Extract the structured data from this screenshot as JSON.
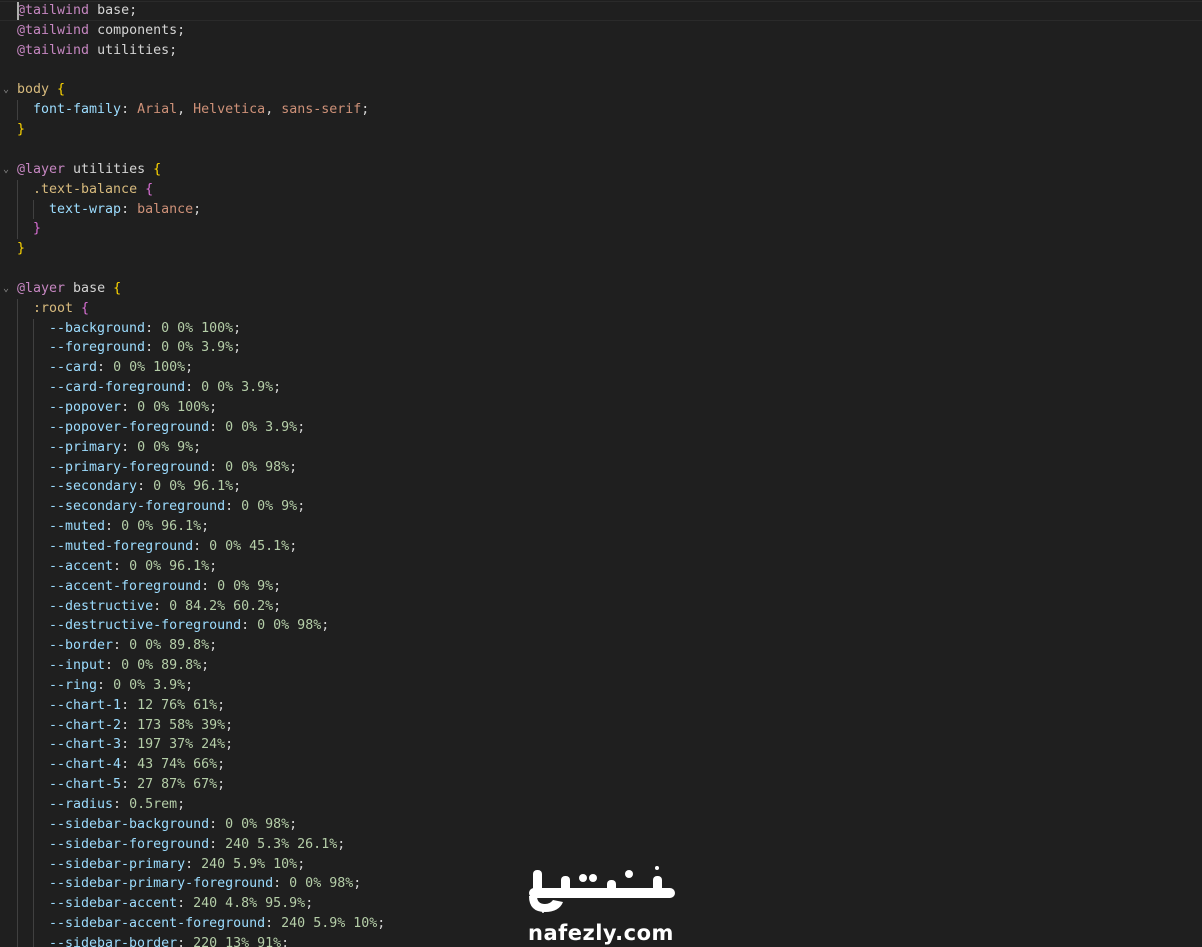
{
  "code": {
    "lines": [
      {
        "tokens": [
          {
            "t": "@tailwind",
            "c": "at"
          },
          {
            "t": " base",
            "c": "plain"
          },
          {
            "t": ";",
            "c": "punct"
          }
        ]
      },
      {
        "tokens": [
          {
            "t": "@tailwind",
            "c": "at"
          },
          {
            "t": " components",
            "c": "plain"
          },
          {
            "t": ";",
            "c": "punct"
          }
        ]
      },
      {
        "tokens": [
          {
            "t": "@tailwind",
            "c": "at"
          },
          {
            "t": " utilities",
            "c": "plain"
          },
          {
            "t": ";",
            "c": "punct"
          }
        ]
      },
      {
        "tokens": []
      },
      {
        "fold": true,
        "tokens": [
          {
            "t": "body",
            "c": "sel"
          },
          {
            "t": " ",
            "c": "plain"
          },
          {
            "t": "{",
            "c": "brace1"
          }
        ]
      },
      {
        "indent": 1,
        "tokens": [
          {
            "t": "font-family",
            "c": "prop"
          },
          {
            "t": ": ",
            "c": "punct"
          },
          {
            "t": "Arial",
            "c": "val"
          },
          {
            "t": ", ",
            "c": "punct"
          },
          {
            "t": "Helvetica",
            "c": "val"
          },
          {
            "t": ", ",
            "c": "punct"
          },
          {
            "t": "sans-serif",
            "c": "val"
          },
          {
            "t": ";",
            "c": "punct"
          }
        ]
      },
      {
        "tokens": [
          {
            "t": "}",
            "c": "brace1"
          }
        ]
      },
      {
        "tokens": []
      },
      {
        "fold": true,
        "tokens": [
          {
            "t": "@layer",
            "c": "at"
          },
          {
            "t": " utilities ",
            "c": "plain"
          },
          {
            "t": "{",
            "c": "brace1"
          }
        ]
      },
      {
        "indent": 1,
        "fold": true,
        "tokens": [
          {
            "t": ".text-balance",
            "c": "sel"
          },
          {
            "t": " ",
            "c": "plain"
          },
          {
            "t": "{",
            "c": "brace2"
          }
        ]
      },
      {
        "indent": 2,
        "tokens": [
          {
            "t": "text-wrap",
            "c": "prop"
          },
          {
            "t": ": ",
            "c": "punct"
          },
          {
            "t": "balance",
            "c": "val"
          },
          {
            "t": ";",
            "c": "punct"
          }
        ]
      },
      {
        "indent": 1,
        "tokens": [
          {
            "t": "}",
            "c": "brace2"
          }
        ]
      },
      {
        "tokens": [
          {
            "t": "}",
            "c": "brace1"
          }
        ]
      },
      {
        "tokens": []
      },
      {
        "fold": true,
        "tokens": [
          {
            "t": "@layer",
            "c": "at"
          },
          {
            "t": " base ",
            "c": "plain"
          },
          {
            "t": "{",
            "c": "brace1"
          }
        ]
      },
      {
        "indent": 1,
        "fold": true,
        "tokens": [
          {
            "t": ":root",
            "c": "sel"
          },
          {
            "t": " ",
            "c": "plain"
          },
          {
            "t": "{",
            "c": "brace2"
          }
        ]
      },
      {
        "indent": 2,
        "tokens": [
          {
            "t": "--background",
            "c": "prop"
          },
          {
            "t": ": ",
            "c": "punct"
          },
          {
            "t": "0 0% 100%",
            "c": "num"
          },
          {
            "t": ";",
            "c": "punct"
          }
        ]
      },
      {
        "indent": 2,
        "tokens": [
          {
            "t": "--foreground",
            "c": "prop"
          },
          {
            "t": ": ",
            "c": "punct"
          },
          {
            "t": "0 0% 3.9%",
            "c": "num"
          },
          {
            "t": ";",
            "c": "punct"
          }
        ]
      },
      {
        "indent": 2,
        "tokens": [
          {
            "t": "--card",
            "c": "prop"
          },
          {
            "t": ": ",
            "c": "punct"
          },
          {
            "t": "0 0% 100%",
            "c": "num"
          },
          {
            "t": ";",
            "c": "punct"
          }
        ]
      },
      {
        "indent": 2,
        "tokens": [
          {
            "t": "--card-foreground",
            "c": "prop"
          },
          {
            "t": ": ",
            "c": "punct"
          },
          {
            "t": "0 0% 3.9%",
            "c": "num"
          },
          {
            "t": ";",
            "c": "punct"
          }
        ]
      },
      {
        "indent": 2,
        "tokens": [
          {
            "t": "--popover",
            "c": "prop"
          },
          {
            "t": ": ",
            "c": "punct"
          },
          {
            "t": "0 0% 100%",
            "c": "num"
          },
          {
            "t": ";",
            "c": "punct"
          }
        ]
      },
      {
        "indent": 2,
        "tokens": [
          {
            "t": "--popover-foreground",
            "c": "prop"
          },
          {
            "t": ": ",
            "c": "punct"
          },
          {
            "t": "0 0% 3.9%",
            "c": "num"
          },
          {
            "t": ";",
            "c": "punct"
          }
        ]
      },
      {
        "indent": 2,
        "tokens": [
          {
            "t": "--primary",
            "c": "prop"
          },
          {
            "t": ": ",
            "c": "punct"
          },
          {
            "t": "0 0% 9%",
            "c": "num"
          },
          {
            "t": ";",
            "c": "punct"
          }
        ]
      },
      {
        "indent": 2,
        "tokens": [
          {
            "t": "--primary-foreground",
            "c": "prop"
          },
          {
            "t": ": ",
            "c": "punct"
          },
          {
            "t": "0 0% 98%",
            "c": "num"
          },
          {
            "t": ";",
            "c": "punct"
          }
        ]
      },
      {
        "indent": 2,
        "tokens": [
          {
            "t": "--secondary",
            "c": "prop"
          },
          {
            "t": ": ",
            "c": "punct"
          },
          {
            "t": "0 0% 96.1%",
            "c": "num"
          },
          {
            "t": ";",
            "c": "punct"
          }
        ]
      },
      {
        "indent": 2,
        "tokens": [
          {
            "t": "--secondary-foreground",
            "c": "prop"
          },
          {
            "t": ": ",
            "c": "punct"
          },
          {
            "t": "0 0% 9%",
            "c": "num"
          },
          {
            "t": ";",
            "c": "punct"
          }
        ]
      },
      {
        "indent": 2,
        "tokens": [
          {
            "t": "--muted",
            "c": "prop"
          },
          {
            "t": ": ",
            "c": "punct"
          },
          {
            "t": "0 0% 96.1%",
            "c": "num"
          },
          {
            "t": ";",
            "c": "punct"
          }
        ]
      },
      {
        "indent": 2,
        "tokens": [
          {
            "t": "--muted-foreground",
            "c": "prop"
          },
          {
            "t": ": ",
            "c": "punct"
          },
          {
            "t": "0 0% 45.1%",
            "c": "num"
          },
          {
            "t": ";",
            "c": "punct"
          }
        ]
      },
      {
        "indent": 2,
        "tokens": [
          {
            "t": "--accent",
            "c": "prop"
          },
          {
            "t": ": ",
            "c": "punct"
          },
          {
            "t": "0 0% 96.1%",
            "c": "num"
          },
          {
            "t": ";",
            "c": "punct"
          }
        ]
      },
      {
        "indent": 2,
        "tokens": [
          {
            "t": "--accent-foreground",
            "c": "prop"
          },
          {
            "t": ": ",
            "c": "punct"
          },
          {
            "t": "0 0% 9%",
            "c": "num"
          },
          {
            "t": ";",
            "c": "punct"
          }
        ]
      },
      {
        "indent": 2,
        "tokens": [
          {
            "t": "--destructive",
            "c": "prop"
          },
          {
            "t": ": ",
            "c": "punct"
          },
          {
            "t": "0 84.2% 60.2%",
            "c": "num"
          },
          {
            "t": ";",
            "c": "punct"
          }
        ]
      },
      {
        "indent": 2,
        "tokens": [
          {
            "t": "--destructive-foreground",
            "c": "prop"
          },
          {
            "t": ": ",
            "c": "punct"
          },
          {
            "t": "0 0% 98%",
            "c": "num"
          },
          {
            "t": ";",
            "c": "punct"
          }
        ]
      },
      {
        "indent": 2,
        "tokens": [
          {
            "t": "--border",
            "c": "prop"
          },
          {
            "t": ": ",
            "c": "punct"
          },
          {
            "t": "0 0% 89.8%",
            "c": "num"
          },
          {
            "t": ";",
            "c": "punct"
          }
        ]
      },
      {
        "indent": 2,
        "tokens": [
          {
            "t": "--input",
            "c": "prop"
          },
          {
            "t": ": ",
            "c": "punct"
          },
          {
            "t": "0 0% 89.8%",
            "c": "num"
          },
          {
            "t": ";",
            "c": "punct"
          }
        ]
      },
      {
        "indent": 2,
        "tokens": [
          {
            "t": "--ring",
            "c": "prop"
          },
          {
            "t": ": ",
            "c": "punct"
          },
          {
            "t": "0 0% 3.9%",
            "c": "num"
          },
          {
            "t": ";",
            "c": "punct"
          }
        ]
      },
      {
        "indent": 2,
        "tokens": [
          {
            "t": "--chart-1",
            "c": "prop"
          },
          {
            "t": ": ",
            "c": "punct"
          },
          {
            "t": "12 76% 61%",
            "c": "num"
          },
          {
            "t": ";",
            "c": "punct"
          }
        ]
      },
      {
        "indent": 2,
        "tokens": [
          {
            "t": "--chart-2",
            "c": "prop"
          },
          {
            "t": ": ",
            "c": "punct"
          },
          {
            "t": "173 58% 39%",
            "c": "num"
          },
          {
            "t": ";",
            "c": "punct"
          }
        ]
      },
      {
        "indent": 2,
        "tokens": [
          {
            "t": "--chart-3",
            "c": "prop"
          },
          {
            "t": ": ",
            "c": "punct"
          },
          {
            "t": "197 37% 24%",
            "c": "num"
          },
          {
            "t": ";",
            "c": "punct"
          }
        ]
      },
      {
        "indent": 2,
        "tokens": [
          {
            "t": "--chart-4",
            "c": "prop"
          },
          {
            "t": ": ",
            "c": "punct"
          },
          {
            "t": "43 74% 66%",
            "c": "num"
          },
          {
            "t": ";",
            "c": "punct"
          }
        ]
      },
      {
        "indent": 2,
        "tokens": [
          {
            "t": "--chart-5",
            "c": "prop"
          },
          {
            "t": ": ",
            "c": "punct"
          },
          {
            "t": "27 87% 67%",
            "c": "num"
          },
          {
            "t": ";",
            "c": "punct"
          }
        ]
      },
      {
        "indent": 2,
        "tokens": [
          {
            "t": "--radius",
            "c": "prop"
          },
          {
            "t": ": ",
            "c": "punct"
          },
          {
            "t": "0.5rem",
            "c": "num"
          },
          {
            "t": ";",
            "c": "punct"
          }
        ]
      },
      {
        "indent": 2,
        "tokens": [
          {
            "t": "--sidebar-background",
            "c": "prop"
          },
          {
            "t": ": ",
            "c": "punct"
          },
          {
            "t": "0 0% 98%",
            "c": "num"
          },
          {
            "t": ";",
            "c": "punct"
          }
        ]
      },
      {
        "indent": 2,
        "tokens": [
          {
            "t": "--sidebar-foreground",
            "c": "prop"
          },
          {
            "t": ": ",
            "c": "punct"
          },
          {
            "t": "240 5.3% 26.1%",
            "c": "num"
          },
          {
            "t": ";",
            "c": "punct"
          }
        ]
      },
      {
        "indent": 2,
        "tokens": [
          {
            "t": "--sidebar-primary",
            "c": "prop"
          },
          {
            "t": ": ",
            "c": "punct"
          },
          {
            "t": "240 5.9% 10%",
            "c": "num"
          },
          {
            "t": ";",
            "c": "punct"
          }
        ]
      },
      {
        "indent": 2,
        "tokens": [
          {
            "t": "--sidebar-primary-foreground",
            "c": "prop"
          },
          {
            "t": ": ",
            "c": "punct"
          },
          {
            "t": "0 0% 98%",
            "c": "num"
          },
          {
            "t": ";",
            "c": "punct"
          }
        ]
      },
      {
        "indent": 2,
        "tokens": [
          {
            "t": "--sidebar-accent",
            "c": "prop"
          },
          {
            "t": ": ",
            "c": "punct"
          },
          {
            "t": "240 4.8% 95.9%",
            "c": "num"
          },
          {
            "t": ";",
            "c": "punct"
          }
        ]
      },
      {
        "indent": 2,
        "tokens": [
          {
            "t": "--sidebar-accent-foreground",
            "c": "prop"
          },
          {
            "t": ": ",
            "c": "punct"
          },
          {
            "t": "240 5.9% 10%",
            "c": "num"
          },
          {
            "t": ";",
            "c": "punct"
          }
        ]
      },
      {
        "indent": 2,
        "tokens": [
          {
            "t": "--sidebar-border",
            "c": "prop"
          },
          {
            "t": ": ",
            "c": "punct"
          },
          {
            "t": "220 13% 91%",
            "c": "num"
          },
          {
            "t": ";",
            "c": "punct"
          }
        ]
      }
    ]
  },
  "watermark": {
    "arabic": "نفذلي",
    "latin": "nafezly.com"
  },
  "colors": {
    "background": "#1f1f1f",
    "at_rule": "#c586c0",
    "selector": "#d7ba7d",
    "property": "#9cdcfe",
    "string_value": "#ce9178",
    "number_value": "#b5cea8",
    "bracket_level1": "#ffd700",
    "bracket_level2": "#da70d6"
  }
}
